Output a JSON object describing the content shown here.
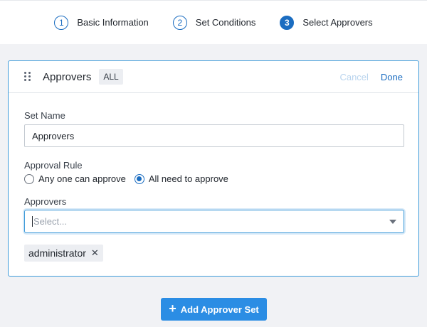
{
  "stepper": {
    "steps": [
      {
        "number": "1",
        "label": "Basic Information",
        "state": "complete"
      },
      {
        "number": "2",
        "label": "Set Conditions",
        "state": "complete"
      },
      {
        "number": "3",
        "label": "Select Approvers",
        "state": "active"
      }
    ]
  },
  "card": {
    "title": "Approvers",
    "badge": "ALL",
    "cancel_label": "Cancel",
    "done_label": "Done",
    "set_name": {
      "label": "Set Name",
      "value": "Approvers"
    },
    "approval_rule": {
      "label": "Approval Rule",
      "options": [
        {
          "label": "Any one can approve",
          "selected": false
        },
        {
          "label": "All need to approve",
          "selected": true
        }
      ]
    },
    "approvers": {
      "label": "Approvers",
      "placeholder": "Select...",
      "selected": [
        "administrator"
      ]
    }
  },
  "footer": {
    "add_button_label": "Add Approver Set"
  },
  "colors": {
    "accent": "#1b6dc1",
    "button": "#2b8de4",
    "focus_border": "#3d9ad9",
    "disabled_text": "#b9d4ee"
  }
}
